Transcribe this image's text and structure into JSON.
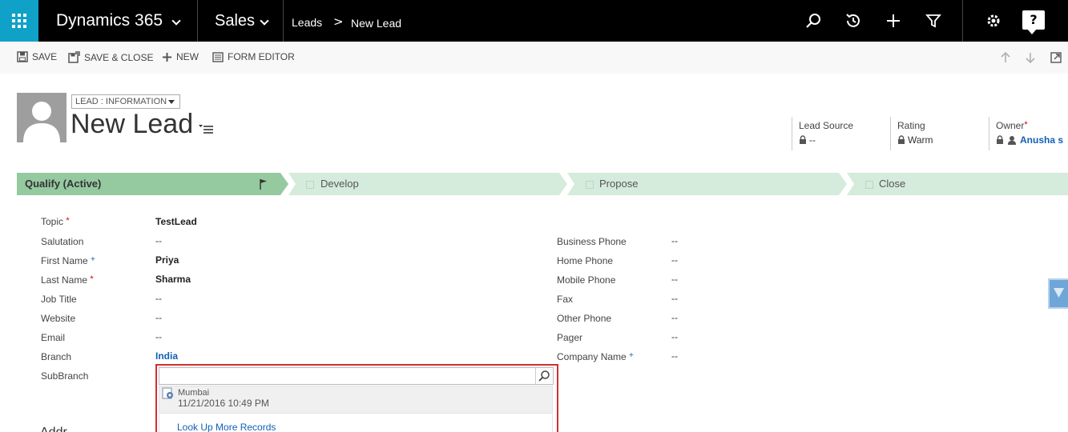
{
  "nav": {
    "app_title": "Dynamics 365",
    "area": "Sales",
    "breadcrumb_parent": "Leads",
    "breadcrumb_separator": ">",
    "breadcrumb_current": "New Lead",
    "help_label": "?",
    "icons": [
      "search-icon",
      "recent-icon",
      "plus-icon",
      "filter-icon",
      "gear-icon",
      "help-icon"
    ]
  },
  "commands": {
    "save": "SAVE",
    "save_close": "SAVE & CLOSE",
    "new": "NEW",
    "form_editor": "FORM EDITOR"
  },
  "header": {
    "form_selector": "LEAD : INFORMATION",
    "title": "New Lead",
    "lead_source_label": "Lead Source",
    "lead_source_value": "--",
    "rating_label": "Rating",
    "rating_value": "Warm",
    "owner_label": "Owner",
    "owner_required": "*",
    "owner_value": "Anusha s"
  },
  "process": {
    "stages": [
      {
        "label": "Qualify (Active)",
        "active": true
      },
      {
        "label": "Develop",
        "active": false
      },
      {
        "label": "Propose",
        "active": false
      },
      {
        "label": "Close",
        "active": false
      }
    ]
  },
  "form": {
    "left": [
      {
        "label": "Topic",
        "marker": "*",
        "value": "TestLead"
      },
      {
        "label": "Salutation",
        "marker": "",
        "value": "--"
      },
      {
        "label": "First Name",
        "marker": "+",
        "value": "Priya"
      },
      {
        "label": "Last Name",
        "marker": "*",
        "value": "Sharma"
      },
      {
        "label": "Job Title",
        "marker": "",
        "value": "--"
      },
      {
        "label": "Website",
        "marker": "",
        "value": "--"
      },
      {
        "label": "Email",
        "marker": "",
        "value": "--"
      },
      {
        "label": "Branch",
        "marker": "",
        "value": "India"
      },
      {
        "label": "SubBranch",
        "marker": "",
        "value": ""
      }
    ],
    "right": [
      {
        "label": "Business Phone",
        "marker": "",
        "value": "--"
      },
      {
        "label": "Home Phone",
        "marker": "",
        "value": "--"
      },
      {
        "label": "Mobile Phone",
        "marker": "",
        "value": "--"
      },
      {
        "label": "Fax",
        "marker": "",
        "value": "--"
      },
      {
        "label": "Other Phone",
        "marker": "",
        "value": "--"
      },
      {
        "label": "Pager",
        "marker": "",
        "value": "--"
      },
      {
        "label": "Company Name",
        "marker": "+",
        "value": "--"
      }
    ]
  },
  "lookup": {
    "input_value": "",
    "result_name": "Mumbai",
    "result_date": "11/21/2016 10:49 PM",
    "more_link": "Look Up More Records"
  },
  "section_peek": "Addr"
}
